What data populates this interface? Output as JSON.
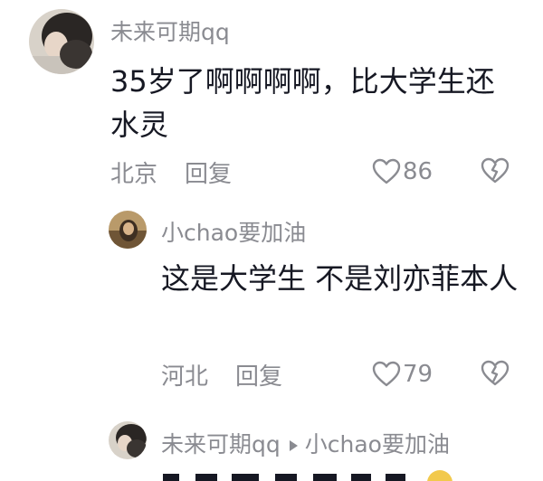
{
  "comments": [
    {
      "username": "未来可期qq",
      "text": "35岁了啊啊啊啊，比大学生还水灵",
      "location": "北京",
      "reply_label": "回复",
      "likes": "86"
    },
    {
      "username": "小chao要加油",
      "text": "这是大学生 不是刘亦菲本人",
      "location": "河北",
      "reply_label": "回复",
      "likes": "79"
    },
    {
      "username": "未来可期qq",
      "reply_to": "小chao要加油"
    }
  ],
  "icons": {
    "like": "heart-outline-icon",
    "dislike": "broken-heart-icon",
    "reply_arrow": "triangle-right-icon"
  },
  "colors": {
    "primary_text": "#161823",
    "secondary_text": "#8a8b91"
  }
}
